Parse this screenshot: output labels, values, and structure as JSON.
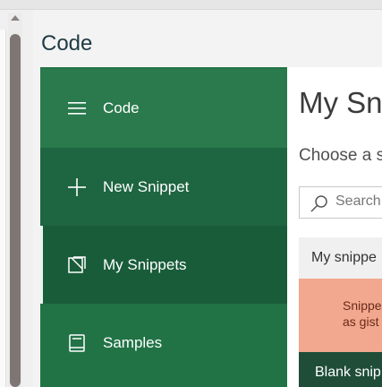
{
  "pane": {
    "title": "Code"
  },
  "nav": {
    "header_label": "Code",
    "items": [
      {
        "label": "New Snippet",
        "icon": "plus-icon",
        "active": false
      },
      {
        "label": "My Snippets",
        "icon": "snippets-icon",
        "active": true
      },
      {
        "label": "Samples",
        "icon": "book-icon",
        "active": false
      }
    ]
  },
  "content": {
    "title": "My Sn",
    "subtitle": "Choose a s",
    "search_placeholder": "Search",
    "section_label": "My snippe",
    "info_line1": "Snippe",
    "info_line2": "as gist",
    "snippet_item": "Blank snip"
  },
  "colors": {
    "nav_green": "#217346",
    "active_green": "#195c3a",
    "info_salmon": "#f2a88e",
    "snippet_dark": "#1f4d38"
  }
}
